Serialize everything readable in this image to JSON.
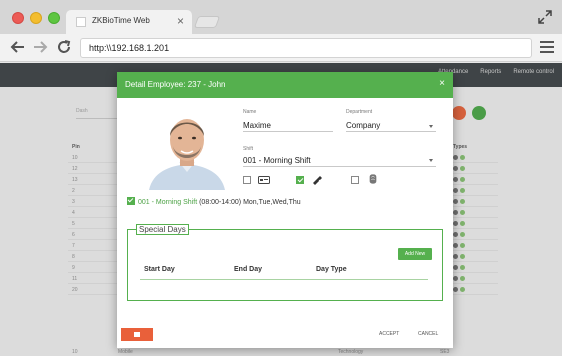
{
  "browser": {
    "tab_title": "ZKBioTime Web",
    "tab_close": "×",
    "url": "http:\\\\192.168.1.201"
  },
  "app": {
    "nav": [
      "Attendance",
      "Reports",
      "Remote control"
    ],
    "search_label": "Dash",
    "table_headers": {
      "first": "Pin",
      "last": "Types"
    },
    "row_pins": [
      "10",
      "12",
      "13",
      "2",
      "3",
      "4",
      "5",
      "6",
      "7",
      "8",
      "9",
      "11",
      "20"
    ],
    "footer": {
      "first": "10",
      "middle_a": "Mobile",
      "middle_b": "Technology",
      "last": "SE3"
    }
  },
  "modal": {
    "title": "Detail Employee: 237 - John",
    "close": "×",
    "name_label": "Name",
    "name_value": "Maxime",
    "department_label": "Department",
    "department_value": "Company",
    "shift_label": "Shift",
    "shift_value": "001 - Morning Shift",
    "verify_modes": [
      {
        "icon": "card-icon",
        "checked": false
      },
      {
        "icon": "password-icon",
        "checked": true
      },
      {
        "icon": "fingerprint-icon",
        "checked": false
      }
    ],
    "shift_summary_name": "001 - Morning Shift",
    "shift_summary_detail": " (08:00-14:00) Mon,Tue,Wed,Thu",
    "special_days": {
      "title": "Special Days",
      "add_button": "Add New",
      "columns": [
        "Start Day",
        "End Day",
        "Day Type"
      ]
    },
    "accept_button": "ACCEPT",
    "cancel_button": "CANCEL"
  },
  "colors": {
    "accent": "#55b04e",
    "danger": "#e9603a",
    "header_dark": "#3f4447"
  }
}
